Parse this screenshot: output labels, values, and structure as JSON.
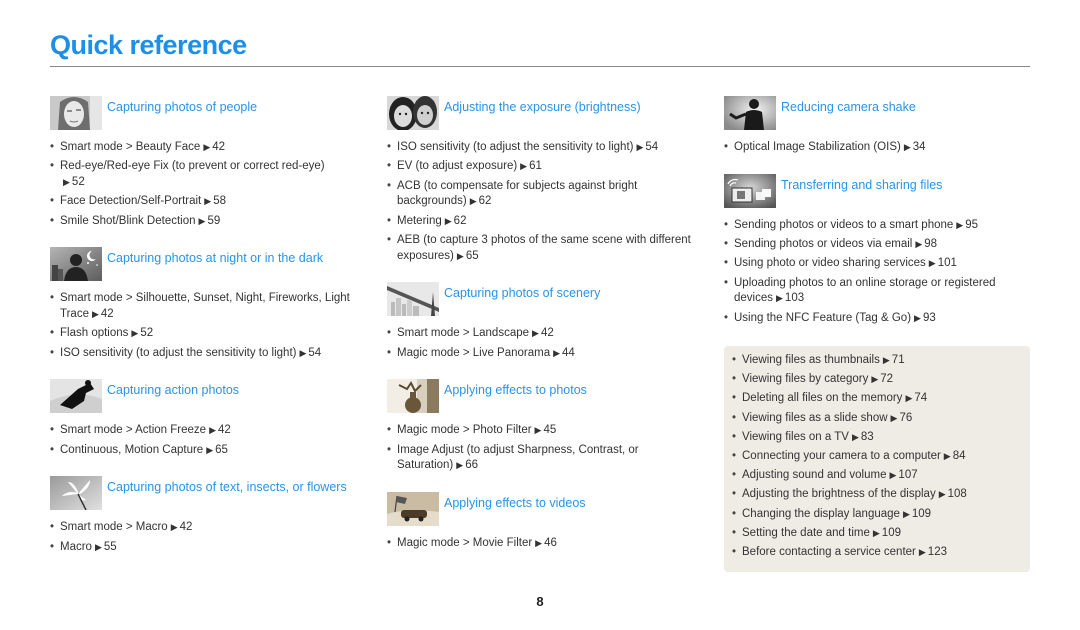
{
  "page": {
    "title": "Quick reference",
    "page_number": "8",
    "arrow_glyph": "▶"
  },
  "columns": [
    {
      "sections": [
        {
          "icon": "portrait-woman-icon",
          "title": "Capturing photos of people",
          "items": [
            {
              "text": "Smart mode > Beauty Face",
              "page": "42"
            },
            {
              "text": "Red-eye/Red-eye Fix (to prevent or correct red-eye)",
              "page": "52"
            },
            {
              "text": "Face Detection/Self-Portrait",
              "page": "58"
            },
            {
              "text": "Smile Shot/Blink Detection",
              "page": "59"
            }
          ]
        },
        {
          "icon": "night-silhouette-icon",
          "title": "Capturing photos at night or in the dark",
          "items": [
            {
              "text": "Smart mode > Silhouette, Sunset, Night, Fireworks, Light Trace",
              "page": "42"
            },
            {
              "text": "Flash options",
              "page": "52"
            },
            {
              "text": "ISO sensitivity (to adjust the sensitivity to light)",
              "page": "54"
            }
          ]
        },
        {
          "icon": "snowboarder-icon",
          "title": "Capturing action photos",
          "items": [
            {
              "text": "Smart mode > Action Freeze",
              "page": "42"
            },
            {
              "text": "Continuous, Motion Capture",
              "page": "65"
            }
          ]
        },
        {
          "icon": "flower-macro-icon",
          "title": "Capturing photos of text, insects, or flowers",
          "items": [
            {
              "text": "Smart mode > Macro",
              "page": "42"
            },
            {
              "text": "Macro",
              "page": "55"
            }
          ]
        }
      ]
    },
    {
      "sections": [
        {
          "icon": "couple-faces-icon",
          "title": "Adjusting the exposure (brightness)",
          "items": [
            {
              "text": "ISO sensitivity (to adjust the sensitivity to light)",
              "page": "54"
            },
            {
              "text": "EV (to adjust exposure)",
              "page": "61"
            },
            {
              "text": "ACB (to compensate for subjects against bright backgrounds)",
              "page": "62"
            },
            {
              "text": "Metering",
              "page": "62"
            },
            {
              "text": "AEB (to capture 3 photos of the same scene with different exposures)",
              "page": "65"
            }
          ]
        },
        {
          "icon": "bridge-city-icon",
          "title": "Capturing photos of scenery",
          "items": [
            {
              "text": "Smart mode > Landscape",
              "page": "42"
            },
            {
              "text": "Magic mode > Live Panorama",
              "page": "44"
            }
          ]
        },
        {
          "icon": "vase-still-life-icon",
          "title": "Applying effects to photos",
          "items": [
            {
              "text": "Magic mode > Photo Filter",
              "page": "45"
            },
            {
              "text": "Image Adjust (to adjust Sharpness, Contrast, or Saturation)",
              "page": "66"
            }
          ]
        },
        {
          "icon": "race-car-flag-icon",
          "title": "Applying effects to videos",
          "items": [
            {
              "text": "Magic mode > Movie Filter",
              "page": "46"
            }
          ]
        }
      ]
    },
    {
      "sections": [
        {
          "icon": "person-waving-icon",
          "title": "Reducing camera shake",
          "items": [
            {
              "text": "Optical Image Stabilization (OIS)",
              "page": "34"
            }
          ]
        },
        {
          "icon": "wifi-transfer-icon",
          "title": "Transferring and sharing files",
          "items": [
            {
              "text": "Sending photos or videos to a smart phone",
              "page": "95"
            },
            {
              "text": "Sending photos or videos via email",
              "page": "98"
            },
            {
              "text": "Using photo or video sharing services",
              "page": "101"
            },
            {
              "text": "Uploading photos to an online storage or registered devices",
              "page": "103"
            },
            {
              "text": "Using the NFC Feature (Tag & Go)",
              "page": "93"
            }
          ]
        }
      ]
    }
  ],
  "graybox": {
    "items": [
      {
        "text": "Viewing files as thumbnails",
        "page": "71"
      },
      {
        "text": "Viewing files by category",
        "page": "72"
      },
      {
        "text": "Deleting all files on the memory",
        "page": "74"
      },
      {
        "text": "Viewing files as a slide show",
        "page": "76"
      },
      {
        "text": "Viewing files on a TV",
        "page": "83"
      },
      {
        "text": "Connecting your camera to a computer",
        "page": "84"
      },
      {
        "text": "Adjusting sound and volume",
        "page": "107"
      },
      {
        "text": "Adjusting the brightness of the display",
        "page": "108"
      },
      {
        "text": "Changing the display language",
        "page": "109"
      },
      {
        "text": "Setting the date and time",
        "page": "109"
      },
      {
        "text": "Before contacting a service center",
        "page": "123"
      }
    ]
  }
}
